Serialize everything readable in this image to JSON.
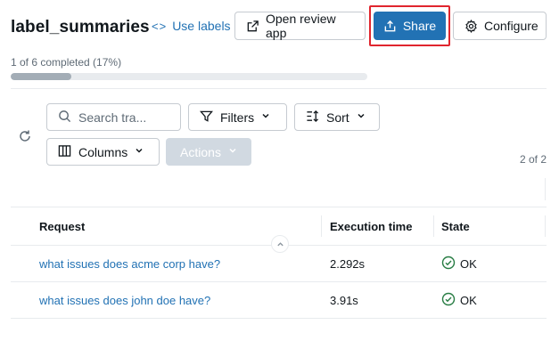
{
  "header": {
    "title": "label_summaries",
    "use_labels": "Use labels",
    "use_labels_icon": "code-brackets-icon",
    "open_review_app": "Open review app",
    "share": "Share",
    "configure": "Configure"
  },
  "colors": {
    "accent": "#2272b4",
    "highlight": "#e0252e",
    "ok_green": "#277c43"
  },
  "progress": {
    "text": "1 of 6 completed (17%)",
    "fraction": 0.17
  },
  "toolbar": {
    "search_placeholder": "Search tra...",
    "filters": "Filters",
    "sort": "Sort",
    "columns": "Columns",
    "actions": "Actions"
  },
  "pager": {
    "text": "2 of 2"
  },
  "table": {
    "headers": {
      "request": "Request",
      "execution_time": "Execution time",
      "state": "State"
    },
    "rows": [
      {
        "request": "what issues does acme corp have?",
        "execution_time": "2.292s",
        "state": "OK"
      },
      {
        "request": "what issues does john doe have?",
        "execution_time": "3.91s",
        "state": "OK"
      }
    ]
  }
}
